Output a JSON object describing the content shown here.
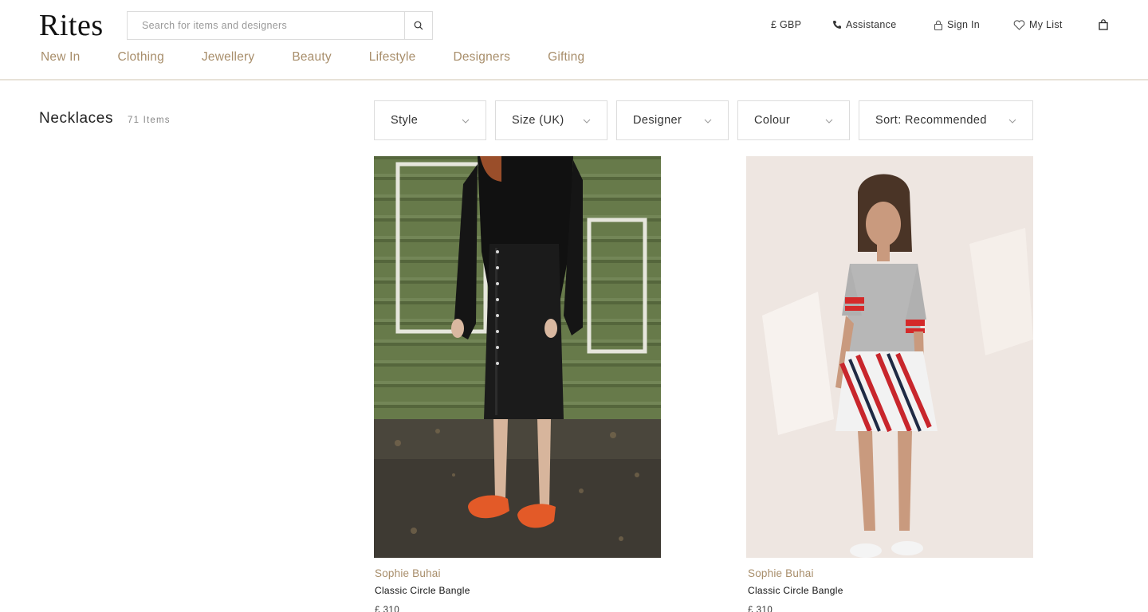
{
  "brand": {
    "logo": "Rites"
  },
  "search": {
    "placeholder": "Search for items and designers"
  },
  "utility": {
    "currency": "£ GBP",
    "assistance": "Assistance",
    "sign_in": "Sign In",
    "my_list": "My List"
  },
  "nav": [
    "New In",
    "Clothing",
    "Jewellery",
    "Beauty",
    "Lifestyle",
    "Designers",
    "Gifting"
  ],
  "category": {
    "title": "Necklaces",
    "count": "71 Items"
  },
  "filters": [
    "Style",
    "Size (UK)",
    "Designer",
    "Colour",
    "Sort: Recommended"
  ],
  "products": [
    {
      "designer": "Sophie Buhai",
      "name": "Classic Circle Bangle",
      "price": "£ 310"
    },
    {
      "designer": "Sophie Buhai",
      "name": "Classic Circle Bangle",
      "price": "£ 310"
    }
  ],
  "colors": {
    "accent": "#a88e6b",
    "border": "#dcdcdc",
    "divider": "#e7e2d8"
  },
  "icons": [
    "search-icon",
    "phone-icon",
    "lock-icon",
    "heart-icon",
    "bag-icon",
    "chevron-down-icon"
  ]
}
